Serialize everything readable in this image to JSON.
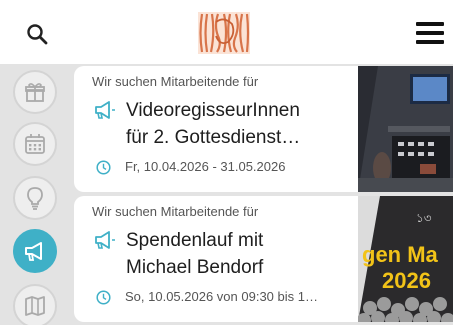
{
  "header": {
    "search_icon": "search-icon",
    "logo_icon": "wood-logo",
    "menu_icon": "hamburger-menu-icon"
  },
  "sidebar": {
    "items": [
      {
        "icon": "gift-icon",
        "active": false
      },
      {
        "icon": "calendar-icon",
        "active": false
      },
      {
        "icon": "lightbulb-icon",
        "active": false
      },
      {
        "icon": "megaphone-icon",
        "active": true
      },
      {
        "icon": "map-icon",
        "active": false
      }
    ],
    "active_color": "#3fb0c7"
  },
  "cards": [
    {
      "eyebrow": "Wir suchen Mitarbeitende für",
      "title": "VideoregisseurInnen\nfür 2. Gottesdienst…",
      "date": "Fr, 10.04.2026 - 31.05.2026",
      "image_icon": "video-studio-photo"
    },
    {
      "eyebrow": "Wir suchen Mitarbeitende für",
      "title": "Spendenlauf mit\nMichael Bendorf",
      "date": "So, 10.05.2026 von 09:30 bis 1…",
      "image_icon": "event-poster-photo",
      "image_text_1": "gen Ma",
      "image_text_2": "2026"
    }
  ],
  "colors": {
    "accent": "#3fb0c7",
    "logo": "#d8744a"
  }
}
